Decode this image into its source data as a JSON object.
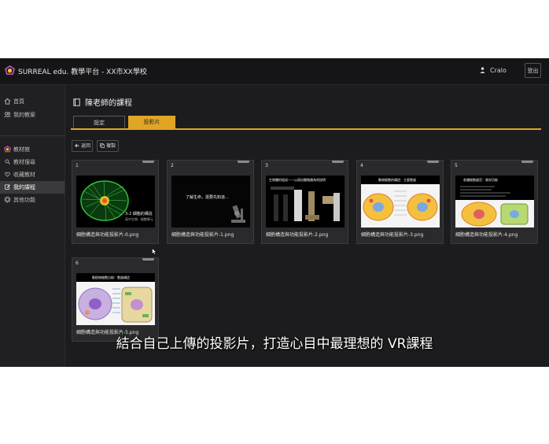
{
  "header": {
    "brand": "SURREAL edu. 教學平台 - XX市XX學校",
    "user_name": "Cralo",
    "logout_label": "登出"
  },
  "sidebar": {
    "items": [
      {
        "label": "首頁",
        "icon": "home-icon"
      },
      {
        "label": "我的教案",
        "icon": "users-icon"
      },
      {
        "label": "教材館",
        "icon": "logo-icon"
      },
      {
        "label": "教材搜尋",
        "icon": "search-icon"
      },
      {
        "label": "收藏教材",
        "icon": "heart-icon"
      },
      {
        "label": "我的課程",
        "icon": "edit-icon"
      },
      {
        "label": "其他功能",
        "icon": "gear-icon"
      }
    ]
  },
  "main": {
    "title": "陳老師的課程",
    "tabs": [
      {
        "label": "設定"
      },
      {
        "label": "投影片"
      }
    ],
    "back_label": "返回",
    "copy_label": "複製"
  },
  "slides": [
    {
      "number": "1",
      "filename": "細胞構造與功能投影片-0.png",
      "caption_title": "3-2 細胞的構造",
      "caption_sub": "高中生物 · 細胞單元"
    },
    {
      "number": "2",
      "filename": "細胞構造與功能投影片-1.png",
      "caption_title": "了解生命，需要先知道..."
    },
    {
      "number": "3",
      "filename": "細胞構造與功能投影片-2.png",
      "caption_title": "生物體的組成——以高倍顯微鏡為例說明"
    },
    {
      "number": "4",
      "filename": "細胞構造與功能投影片-3.png",
      "caption_title": "動物細胞的構造：主要胞器"
    },
    {
      "number": "5",
      "filename": "細胞構造與功能投影片-4.png",
      "caption_title": "各種細胞器官：質與功能"
    },
    {
      "number": "6",
      "filename": "細胞構造與功能投影片-5.png",
      "caption_title": "動植物細胞比較：胞器構造"
    }
  ],
  "subtitle": "結合自己上傳的投影片，打造心目中最理想的 VR課程",
  "colors": {
    "accent": "#e0a524",
    "background": "#1c1c1e",
    "card": "#2a2a2c"
  }
}
